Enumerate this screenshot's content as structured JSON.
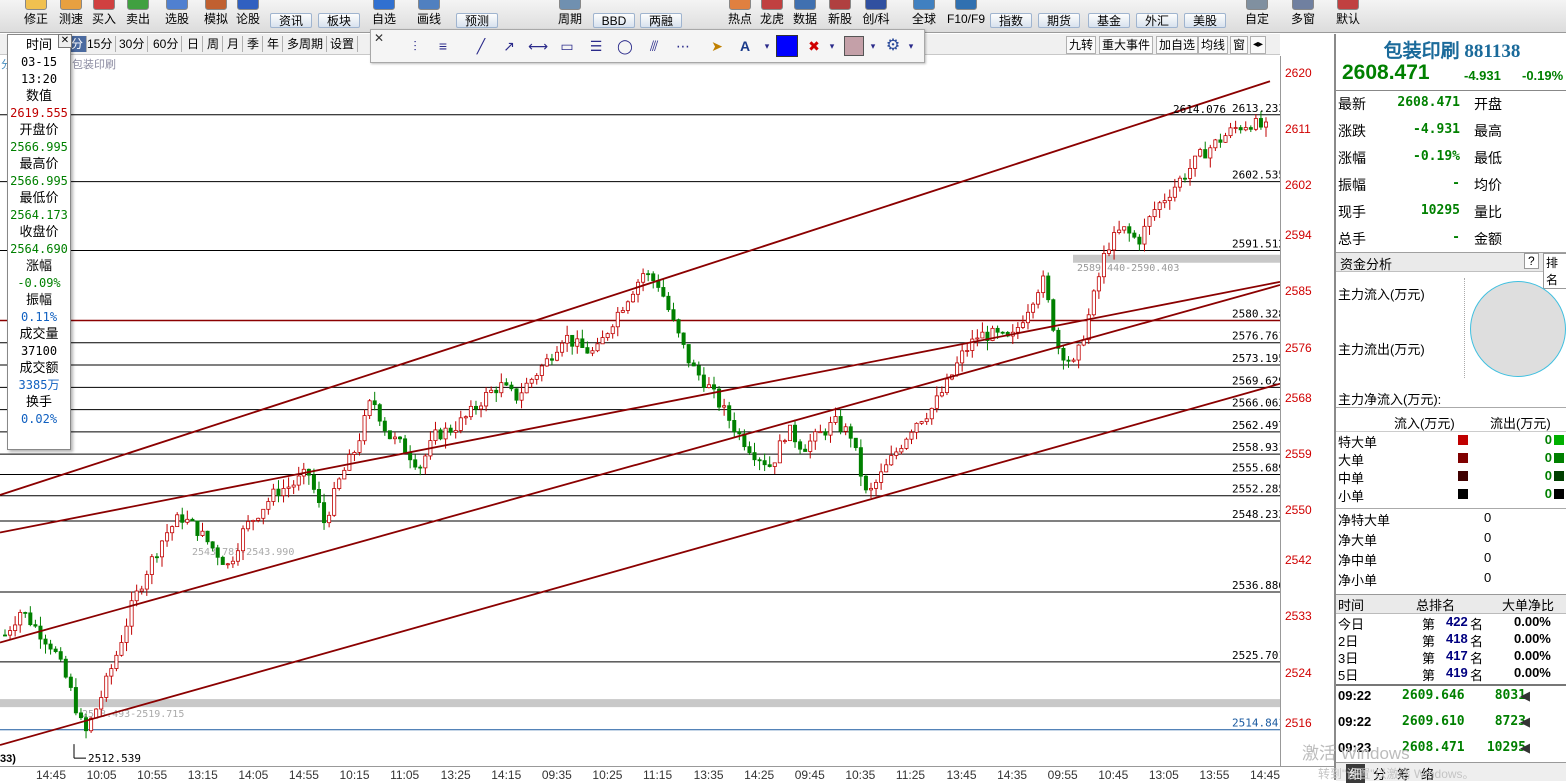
{
  "toolbar": {
    "items": [
      {
        "label": "修正",
        "icon": "edit-icon"
      },
      {
        "label": "测速",
        "icon": "speed-icon"
      },
      {
        "label": "买入",
        "icon": "buy-icon"
      },
      {
        "label": "卖出",
        "icon": "sell-icon"
      },
      {
        "label": "选股",
        "icon": "select-stock-icon"
      },
      {
        "label": "模拟",
        "icon": "simulate-icon"
      },
      {
        "label": "论股",
        "icon": "forum-icon"
      },
      {
        "label": "自选",
        "icon": "favorites-icon"
      },
      {
        "label": "画线",
        "icon": "draw-line-icon"
      },
      {
        "label": "周期",
        "icon": "period-icon"
      },
      {
        "label": "热点",
        "icon": "hotspot-icon"
      },
      {
        "label": "龙虎",
        "icon": "dragon-tiger-icon"
      },
      {
        "label": "数据",
        "icon": "data-icon"
      },
      {
        "label": "新股",
        "icon": "new-stock-icon"
      },
      {
        "label": "创/科",
        "icon": "gem-star-icon"
      },
      {
        "label": "全球",
        "icon": "globe-icon"
      },
      {
        "label": "F10/F9",
        "icon": "f10-icon"
      },
      {
        "label": "自定",
        "icon": "custom-icon"
      },
      {
        "label": "多窗",
        "icon": "multi-window-icon"
      },
      {
        "label": "默认",
        "icon": "default-icon"
      }
    ],
    "pills": [
      "资讯",
      "板块",
      "预测",
      "BBD",
      "两融",
      "指数",
      "期货",
      "基金",
      "外汇",
      "美股"
    ]
  },
  "period_bar": {
    "items": [
      "分",
      "15分",
      "30分",
      "60分",
      "日",
      "周",
      "月",
      "季",
      "年",
      "多周期",
      "设置"
    ],
    "right_items": [
      "九转",
      "重大事件",
      "加自选",
      "均线",
      "窗"
    ]
  },
  "info_panel": {
    "rows": [
      {
        "label": "时间",
        "value": "03-15"
      },
      {
        "label": "",
        "value": "13:20"
      },
      {
        "label": "数值",
        "value": "2619.555",
        "color": "#c00000"
      },
      {
        "label": "开盘价",
        "value": "2566.995",
        "color": "#008000"
      },
      {
        "label": "最高价",
        "value": "2566.995",
        "color": "#008000"
      },
      {
        "label": "最低价",
        "value": "2564.173",
        "color": "#008000"
      },
      {
        "label": "收盘价",
        "value": "2564.690",
        "color": "#008000"
      },
      {
        "label": "涨幅",
        "value": "-0.09%",
        "color": "#008000"
      },
      {
        "label": "振幅",
        "value": "0.11%",
        "color": "#1060c0"
      },
      {
        "label": "成交量",
        "value": "37100",
        "color": "#000000"
      },
      {
        "label": "成交额",
        "value": "3385万",
        "color": "#1060c0"
      },
      {
        "label": "换手",
        "value": "0.02%",
        "color": "#1060c0"
      }
    ]
  },
  "chart": {
    "symbol_label": "包装印刷",
    "left_marker": "分",
    "y_ticks": [
      "2620",
      "2611",
      "2602",
      "2594",
      "2585",
      "2576",
      "2568",
      "2559",
      "2550",
      "2542",
      "2533",
      "2524",
      "2516"
    ],
    "x_ticks": [
      "14:45",
      "10:05",
      "10:55",
      "13:15",
      "14:05",
      "14:55",
      "10:15",
      "11:05",
      "13:25",
      "14:15",
      "09:35",
      "10:25",
      "11:15",
      "13:35",
      "14:25",
      "09:45",
      "10:35",
      "11:25",
      "13:45",
      "14:35",
      "09:55",
      "10:45",
      "13:05",
      "13:55",
      "14:45"
    ],
    "level_labels": [
      "2613.233",
      "2602.535",
      "2591.512",
      "2580.328",
      "2576.761",
      "2573.195",
      "2569.629",
      "2566.063",
      "2562.497",
      "2558.931",
      "2555.689",
      "2552.285",
      "2548.233",
      "2536.886",
      "2525.701",
      "2514.841"
    ],
    "annotations": {
      "high_mark": "2614.076",
      "low_mark": "2512.539",
      "zone_top": "2589.440-2590.403",
      "zone_mid": "2543.781-2543.990",
      "zone_low": "2518.493-2519.715",
      "left_cut": "33)"
    }
  },
  "chart_data": {
    "type": "candlestick",
    "title": "包装印刷",
    "ylim": [
      2510,
      2622
    ],
    "y_ticks": [
      2620,
      2611,
      2602,
      2594,
      2585,
      2576,
      2568,
      2559,
      2550,
      2542,
      2533,
      2524,
      2516
    ],
    "x_ticks": [
      "14:45",
      "10:05",
      "10:55",
      "13:15",
      "14:05",
      "14:55",
      "10:15",
      "11:05",
      "13:25",
      "14:15",
      "09:35",
      "10:25",
      "11:15",
      "13:35",
      "14:25",
      "09:45",
      "10:35",
      "11:25",
      "13:45",
      "14:35",
      "09:55",
      "10:45",
      "13:05",
      "13:55",
      "14:45"
    ],
    "horizontal_levels": [
      2613.233,
      2602.535,
      2591.512,
      2580.328,
      2576.761,
      2573.195,
      2569.629,
      2566.063,
      2562.497,
      2558.931,
      2555.689,
      2552.285,
      2548.233,
      2536.886,
      2525.701,
      2514.841
    ],
    "close_path": [
      2530,
      2534,
      2531,
      2528,
      2522,
      2514,
      2520,
      2527,
      2535,
      2541,
      2546,
      2549,
      2547,
      2544,
      2541,
      2547,
      2550,
      2553,
      2554,
      2556,
      2548,
      2555,
      2560,
      2568,
      2562,
      2560,
      2557,
      2562,
      2563,
      2565,
      2568,
      2570,
      2568,
      2571,
      2574,
      2578,
      2576,
      2575,
      2580,
      2584,
      2588,
      2586,
      2579,
      2573,
      2570,
      2566,
      2562,
      2559,
      2557,
      2563,
      2560,
      2562,
      2564,
      2562,
      2552,
      2556,
      2560,
      2564,
      2566,
      2570,
      2575,
      2578,
      2578,
      2577,
      2582,
      2587,
      2576,
      2573,
      2582,
      2592,
      2595,
      2593,
      2598,
      2601,
      2604,
      2607,
      2609,
      2611,
      2612,
      2611
    ]
  },
  "right_panel": {
    "stock_name": "包装印刷",
    "stock_code": "881138",
    "price": "2608.471",
    "change": "-4.931",
    "change_pct": "-0.19%",
    "quote_rows": [
      {
        "label": "最新",
        "value": "2608.471",
        "right_label": "开盘"
      },
      {
        "label": "涨跌",
        "value": "-4.931",
        "right_label": "最高"
      },
      {
        "label": "涨幅",
        "value": "-0.19%",
        "right_label": "最低"
      },
      {
        "label": "振幅",
        "value": "-",
        "right_label": "均价"
      },
      {
        "label": "现手",
        "value": "10295",
        "right_label": "量比"
      },
      {
        "label": "总手",
        "value": "-",
        "right_label": "金额"
      }
    ],
    "fund_title": "资金分析",
    "fund_help": "?",
    "fund_tab": "排名",
    "fund_inflow": "主力流入(万元)",
    "fund_outflow": "主力流出(万元)",
    "fund_net": "主力净流入(万元):",
    "flow_header_in": "流入(万元)",
    "flow_header_out": "流出(万元)",
    "flow_rows": [
      {
        "label": "特大单",
        "in": "0",
        "out": "0"
      },
      {
        "label": "大单",
        "in": "0",
        "out": "0"
      },
      {
        "label": "中单",
        "in": "0",
        "out": "0"
      },
      {
        "label": "小单",
        "in": "0",
        "out": "0"
      }
    ],
    "net_rows": [
      {
        "label": "净特大单",
        "value": "0"
      },
      {
        "label": "净大单",
        "value": "0"
      },
      {
        "label": "净中单",
        "value": "0"
      },
      {
        "label": "净小单",
        "value": "0"
      }
    ],
    "rank_headers": [
      "时间",
      "总排名",
      "大单净比"
    ],
    "rank_rows": [
      {
        "day": "今日",
        "prefix": "第",
        "rank": "422",
        "suffix": "名",
        "ratio": "0.00%"
      },
      {
        "day": "2日",
        "prefix": "第",
        "rank": "418",
        "suffix": "名",
        "ratio": "0.00%"
      },
      {
        "day": "3日",
        "prefix": "第",
        "rank": "417",
        "suffix": "名",
        "ratio": "0.00%"
      },
      {
        "day": "5日",
        "prefix": "第",
        "rank": "419",
        "suffix": "名",
        "ratio": "0.00%"
      }
    ],
    "ticks": [
      {
        "time": "09:22",
        "price": "2609.646",
        "vol": "8031"
      },
      {
        "time": "09:22",
        "price": "2609.610",
        "vol": "8723"
      },
      {
        "time": "09:23",
        "price": "2608.471",
        "vol": "10295"
      }
    ],
    "bottom_tabs": [
      "细",
      "分",
      "筹",
      "络"
    ],
    "watermark_1": "激活 Windows",
    "watermark_2": "转到\"设置\"以激活 Windows。"
  }
}
